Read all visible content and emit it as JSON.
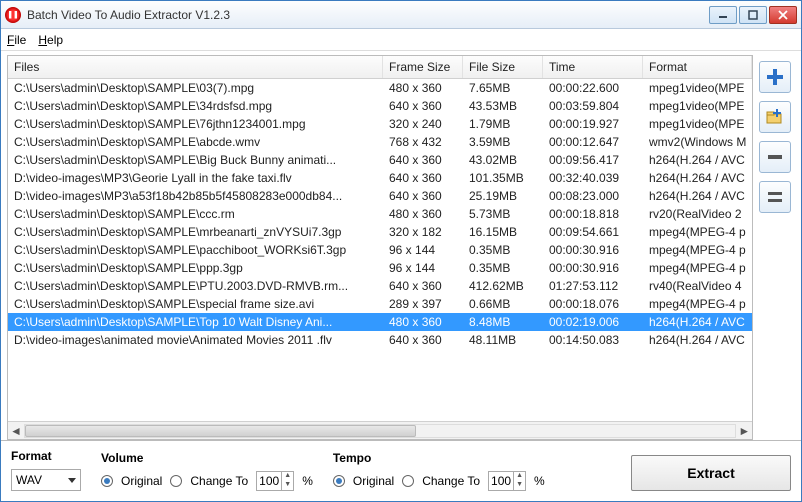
{
  "title": "Batch Video To Audio Extractor V1.2.3",
  "menu": {
    "file": "File",
    "help": "Help"
  },
  "columns": {
    "files": "Files",
    "frame": "Frame Size",
    "size": "File Size",
    "time": "Time",
    "format": "Format"
  },
  "rows": [
    {
      "file": "C:\\Users\\admin\\Desktop\\SAMPLE\\03(7).mpg",
      "frame": "480 x 360",
      "size": "7.65MB",
      "time": "00:00:22.600",
      "format": "mpeg1video(MPE"
    },
    {
      "file": "C:\\Users\\admin\\Desktop\\SAMPLE\\34rdsfsd.mpg",
      "frame": "640 x 360",
      "size": "43.53MB",
      "time": "00:03:59.804",
      "format": "mpeg1video(MPE"
    },
    {
      "file": "C:\\Users\\admin\\Desktop\\SAMPLE\\76jthn1234001.mpg",
      "frame": "320 x 240",
      "size": "1.79MB",
      "time": "00:00:19.927",
      "format": "mpeg1video(MPE"
    },
    {
      "file": "C:\\Users\\admin\\Desktop\\SAMPLE\\abcde.wmv",
      "frame": "768 x 432",
      "size": "3.59MB",
      "time": "00:00:12.647",
      "format": "wmv2(Windows M"
    },
    {
      "file": "C:\\Users\\admin\\Desktop\\SAMPLE\\Big Buck Bunny animati...",
      "frame": "640 x 360",
      "size": "43.02MB",
      "time": "00:09:56.417",
      "format": "h264(H.264 / AVC"
    },
    {
      "file": "D:\\video-images\\MP3\\Georie Lyall in the fake taxi.flv",
      "frame": "640 x 360",
      "size": "101.35MB",
      "time": "00:32:40.039",
      "format": "h264(H.264 / AVC"
    },
    {
      "file": "D:\\video-images\\MP3\\a53f18b42b85b5f45808283e000db84...",
      "frame": "640 x 360",
      "size": "25.19MB",
      "time": "00:08:23.000",
      "format": "h264(H.264 / AVC"
    },
    {
      "file": "C:\\Users\\admin\\Desktop\\SAMPLE\\ccc.rm",
      "frame": "480 x 360",
      "size": "5.73MB",
      "time": "00:00:18.818",
      "format": "rv20(RealVideo 2"
    },
    {
      "file": "C:\\Users\\admin\\Desktop\\SAMPLE\\mrbeanarti_znVYSUi7.3gp",
      "frame": "320 x 182",
      "size": "16.15MB",
      "time": "00:09:54.661",
      "format": "mpeg4(MPEG-4 p"
    },
    {
      "file": "C:\\Users\\admin\\Desktop\\SAMPLE\\pacchiboot_WORKsi6T.3gp",
      "frame": "96 x 144",
      "size": "0.35MB",
      "time": "00:00:30.916",
      "format": "mpeg4(MPEG-4 p"
    },
    {
      "file": "C:\\Users\\admin\\Desktop\\SAMPLE\\ppp.3gp",
      "frame": "96 x 144",
      "size": "0.35MB",
      "time": "00:00:30.916",
      "format": "mpeg4(MPEG-4 p"
    },
    {
      "file": "C:\\Users\\admin\\Desktop\\SAMPLE\\PTU.2003.DVD-RMVB.rm...",
      "frame": "640 x 360",
      "size": "412.62MB",
      "time": "01:27:53.112",
      "format": "rv40(RealVideo 4"
    },
    {
      "file": "C:\\Users\\admin\\Desktop\\SAMPLE\\special frame size.avi",
      "frame": "289 x 397",
      "size": "0.66MB",
      "time": "00:00:18.076",
      "format": "mpeg4(MPEG-4 p"
    },
    {
      "file": "C:\\Users\\admin\\Desktop\\SAMPLE\\Top 10 Walt Disney Ani...",
      "frame": "480 x 360",
      "size": "8.48MB",
      "time": "00:02:19.006",
      "format": "h264(H.264 / AVC",
      "selected": true
    },
    {
      "file": "D:\\video-images\\animated movie\\Animated Movies 2011 .flv",
      "frame": "640 x 360",
      "size": "48.11MB",
      "time": "00:14:50.083",
      "format": "h264(H.264 / AVC"
    }
  ],
  "bottom": {
    "format_label": "Format",
    "format_value": "WAV",
    "volume_label": "Volume",
    "tempo_label": "Tempo",
    "original": "Original",
    "change_to": "Change To",
    "percent": "%",
    "spin_value": "100",
    "extract": "Extract"
  }
}
